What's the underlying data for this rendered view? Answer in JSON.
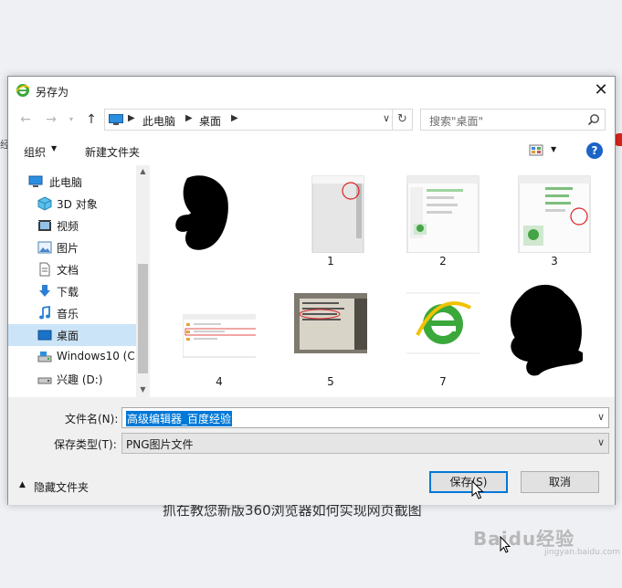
{
  "background": {
    "article_line": "抓在教您新版360浏览器如何实现网页截图",
    "watermark": "Baidu经验",
    "watermark_sub": "jingyan.baidu.com"
  },
  "dialog": {
    "title": "另存为",
    "address": {
      "crumbs": [
        "此电脑",
        "桌面"
      ]
    },
    "search": {
      "placeholder": "搜索\"桌面\""
    },
    "toolbar": {
      "organize": "组织",
      "new_folder": "新建文件夹"
    },
    "nav_items": [
      {
        "label": "此电脑",
        "icon": "computer-icon"
      },
      {
        "label": "3D 对象",
        "icon": "3d-objects-icon"
      },
      {
        "label": "视频",
        "icon": "video-icon"
      },
      {
        "label": "图片",
        "icon": "pictures-icon"
      },
      {
        "label": "文档",
        "icon": "documents-icon"
      },
      {
        "label": "下载",
        "icon": "download-icon"
      },
      {
        "label": "音乐",
        "icon": "music-icon"
      },
      {
        "label": "桌面",
        "icon": "desktop-icon"
      },
      {
        "label": "Windows10 (C:",
        "icon": "drive-icon"
      },
      {
        "label": "兴趣 (D:)",
        "icon": "drive-icon"
      }
    ],
    "files": [
      {
        "label": "",
        "thumb": "redacted-blob"
      },
      {
        "label": "1",
        "thumb": "screenshot"
      },
      {
        "label": "2",
        "thumb": "screenshot"
      },
      {
        "label": "3",
        "thumb": "screenshot"
      },
      {
        "label": "4",
        "thumb": "screenshot"
      },
      {
        "label": "5",
        "thumb": "photo"
      },
      {
        "label": "7",
        "thumb": "ie-logo"
      },
      {
        "label": "",
        "thumb": "redacted-blob"
      }
    ],
    "filename_label": "文件名(N):",
    "filename_value": "高级编辑器_百度经验",
    "filetype_label": "保存类型(T):",
    "filetype_value": "PNG图片文件",
    "hide_folders": "隐藏文件夹",
    "save_button": "保存(S)",
    "cancel_button": "取消",
    "colors": {
      "accent": "#0078d7",
      "selected_nav": "#cce4f7",
      "help": "#1a64c8",
      "ie_green": "#3aa83a"
    }
  }
}
